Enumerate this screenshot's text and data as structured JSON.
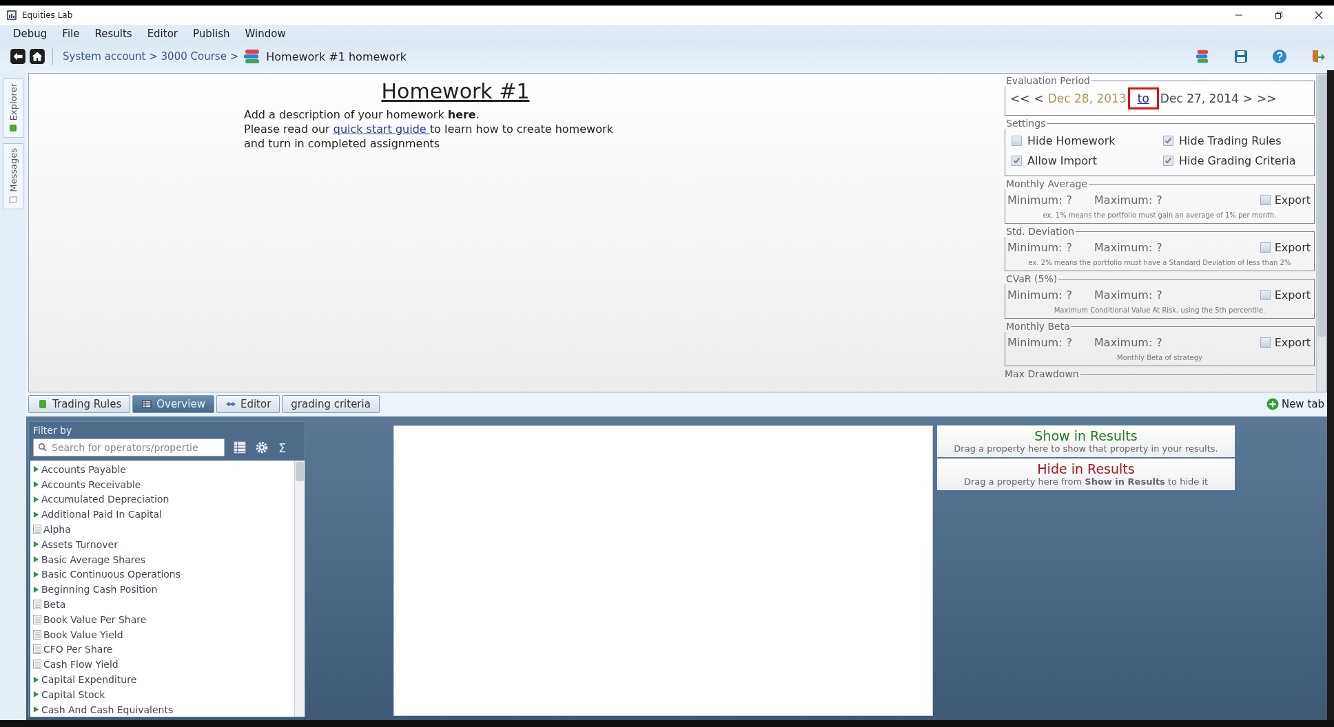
{
  "window": {
    "title": "Equities Lab"
  },
  "menu": [
    "Debug",
    "File",
    "Results",
    "Editor",
    "Publish",
    "Window"
  ],
  "breadcrumb": {
    "path": "System account > 3000 Course >",
    "current": "Homework #1 homework"
  },
  "side_tabs": [
    "Explorer",
    "Messages"
  ],
  "homework": {
    "title": "Homework #1",
    "intro": "Add a description of your homework **here**.",
    "guide_before": "Please read our",
    "guide_link": "quick start guide",
    "guide_after": "to learn how to create homework",
    "last_line": "and turn in completed assignments"
  },
  "evaluation_period": {
    "label": "Evaluation Period",
    "first": "<<",
    "prev": "<",
    "start": "Dec 28, 2013",
    "separator": "to",
    "end": "Dec 27, 2014",
    "next": ">",
    "last": ">>",
    "highlighted": true
  },
  "settings": {
    "label": "Settings",
    "options": [
      {
        "label": "Hide Homework",
        "checked": false
      },
      {
        "label": "Hide Trading Rules",
        "checked": true
      },
      {
        "label": "Allow Import",
        "checked": true
      },
      {
        "label": "Hide Grading Criteria",
        "checked": true
      }
    ]
  },
  "criteria": [
    {
      "title": "Monthly Average",
      "minimum_label": "Minimum:",
      "minimum": "?",
      "maximum_label": "Maximum:",
      "maximum": "?",
      "export_label": "Export",
      "export": false,
      "note": "ex. 1% means the portfolio must gain an average of 1% per month."
    },
    {
      "title": "Std. Deviation",
      "minimum_label": "Minimum:",
      "minimum": "?",
      "maximum_label": "Maximum:",
      "maximum": "?",
      "export_label": "Export",
      "export": false,
      "note": "ex. 2% means the portfolio must have a Standard Deviation of less than 2%"
    },
    {
      "title": "CVaR (5%)",
      "minimum_label": "Minimum:",
      "minimum": "?",
      "maximum_label": "Maximum:",
      "maximum": "?",
      "export_label": "Export",
      "export": false,
      "note": "Maximum Conditional Value At Risk, using the 5th percentile."
    },
    {
      "title": "Monthly Beta",
      "minimum_label": "Minimum:",
      "minimum": "?",
      "maximum_label": "Maximum:",
      "maximum": "?",
      "export_label": "Export",
      "export": false,
      "note": "Monthly Beta of strategy"
    },
    {
      "title": "Max Drawdown"
    }
  ],
  "tabs": [
    {
      "label": "Trading Rules",
      "kind": "rules",
      "selected": false
    },
    {
      "label": "Overview",
      "kind": "overview",
      "selected": true
    },
    {
      "label": "Editor",
      "kind": "editor",
      "selected": false
    },
    {
      "label": "grading criteria",
      "kind": "plain",
      "selected": false
    }
  ],
  "new_tab": "New tab",
  "filter": {
    "title": "Filter by",
    "placeholder": "Search for operators/propertie",
    "sum_symbol": "Σ",
    "items": [
      {
        "label": "Accounts Payable",
        "kind": "group"
      },
      {
        "label": "Accounts Receivable",
        "kind": "group"
      },
      {
        "label": "Accumulated Depreciation",
        "kind": "group"
      },
      {
        "label": "Additional Paid In Capital",
        "kind": "group"
      },
      {
        "label": "Alpha",
        "kind": "property"
      },
      {
        "label": "Assets Turnover",
        "kind": "group"
      },
      {
        "label": "Basic Average Shares",
        "kind": "group"
      },
      {
        "label": "Basic Continuous Operations",
        "kind": "group"
      },
      {
        "label": "Beginning Cash Position",
        "kind": "group"
      },
      {
        "label": "Beta",
        "kind": "property"
      },
      {
        "label": "Book Value Per Share",
        "kind": "property"
      },
      {
        "label": "Book Value Yield",
        "kind": "property"
      },
      {
        "label": "CFO Per Share",
        "kind": "property"
      },
      {
        "label": "Cash Flow Yield",
        "kind": "property"
      },
      {
        "label": "Capital Expenditure",
        "kind": "group"
      },
      {
        "label": "Capital Stock",
        "kind": "group"
      },
      {
        "label": "Cash And Cash Equivalents",
        "kind": "group"
      }
    ]
  },
  "drop_zones": [
    {
      "title": "Show in Results",
      "hint": "Drag a property here to show that property in your results.",
      "color": "#237a23"
    },
    {
      "title": "Hide in Results",
      "hint": "Drag a property here from **Show in Results** to hide it",
      "color": "#a8161c"
    }
  ]
}
